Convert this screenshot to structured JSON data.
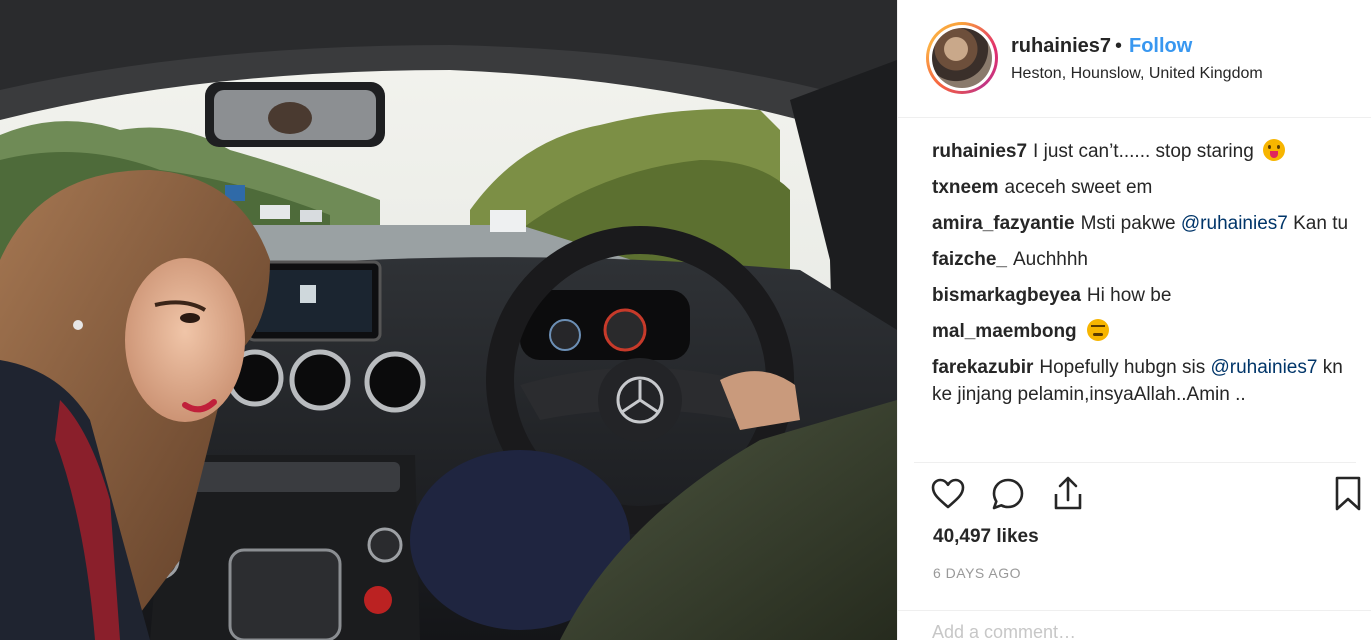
{
  "post": {
    "username": "ruhainies7",
    "separator": "•",
    "follow_label": "Follow",
    "location": "Heston, Hounslow, United Kingdom"
  },
  "comments": [
    {
      "user": "ruhainies7",
      "text": "I just can’t...... stop staring",
      "emoji": "face-with-tongue-icon"
    },
    {
      "user": "txneem",
      "text": "aceceh sweet em"
    },
    {
      "user": "amira_fazyantie",
      "text": "Msti pakwe ",
      "mention": "@ruhainies7",
      "text2": " Kan tu"
    },
    {
      "user": "faizche_",
      "text": "Auchhhh"
    },
    {
      "user": "bismarkagbeyea",
      "text": "Hi how be"
    },
    {
      "user": "mal_maembong",
      "text": "",
      "emoji": "confounded-face-icon"
    },
    {
      "user": "farekazubir",
      "text": "Hopefully hubgn sis ",
      "mention": "@ruhainies7",
      "text2": " kn ke jinjang pelamin,insyaAllah..Amin .."
    }
  ],
  "actions": {
    "like_icon": "heart-icon",
    "comment_icon": "comment-icon",
    "share_icon": "share-icon",
    "save_icon": "bookmark-icon"
  },
  "likes_text": "40,497 likes",
  "timestamp": "6 DAYS AGO",
  "add_comment_placeholder": "Add a comment…",
  "colors": {
    "link_blue": "#3897f0",
    "mention_blue": "#003569",
    "text": "#262626",
    "muted": "#999999"
  }
}
